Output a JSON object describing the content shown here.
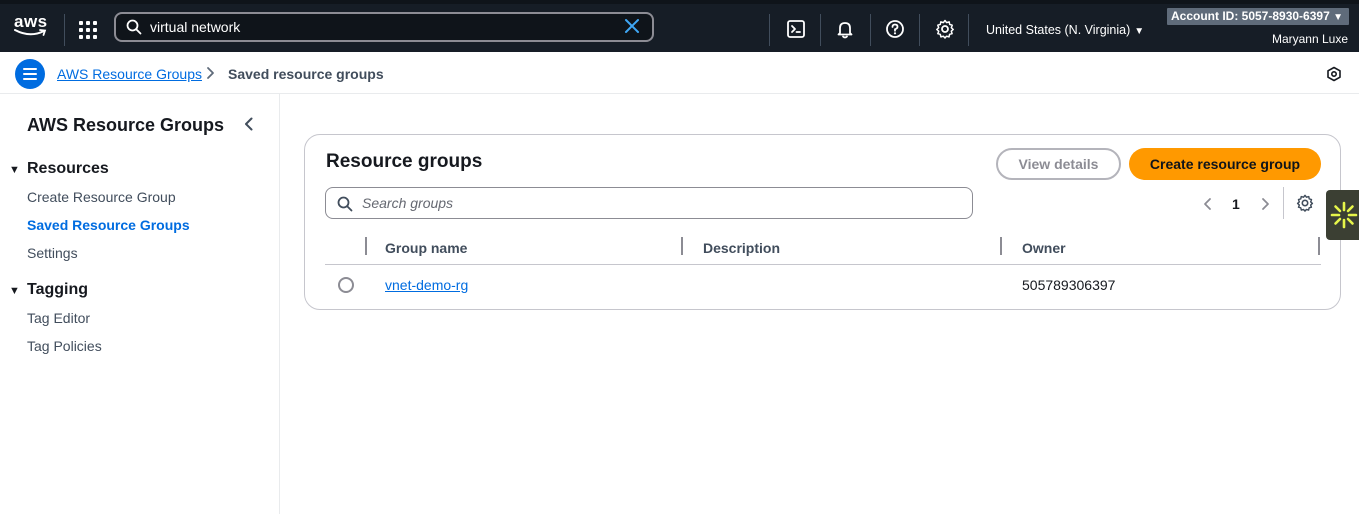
{
  "topnav": {
    "logo_text": "aws",
    "search_value": "virtual network",
    "region": "United States (N. Virginia)",
    "account": "Account ID: 5057-8930-6397",
    "user": "Maryann Luxe",
    "icons": [
      "grid-icon",
      "search-icon",
      "clear-icon",
      "cloudshell-icon",
      "bell-icon",
      "help-icon",
      "gear-icon"
    ]
  },
  "breadcrumb": {
    "link": "AWS Resource Groups",
    "current": "Saved resource groups"
  },
  "sidebar": {
    "title": "AWS Resource Groups",
    "sections": [
      {
        "label": "Resources",
        "items": [
          "Create Resource Group",
          "Saved Resource Groups",
          "Settings"
        ],
        "active": "Saved Resource Groups"
      },
      {
        "label": "Tagging",
        "items": [
          "Tag Editor",
          "Tag Policies"
        ]
      }
    ]
  },
  "main": {
    "title": "Resource groups",
    "view_details_label": "View details",
    "create_label": "Create resource group",
    "search_placeholder": "Search groups",
    "page": "1",
    "columns": [
      "Group name",
      "Description",
      "Owner"
    ],
    "rows": [
      {
        "group_name": "vnet-demo-rg",
        "description": "",
        "owner": "505789306397"
      }
    ]
  },
  "colors": {
    "nav_bg": "#161d26",
    "link": "#006ce0",
    "primary_button": "#ff9900",
    "widget_bg": "#3b3f33",
    "widget_accent": "#e6f54a"
  }
}
